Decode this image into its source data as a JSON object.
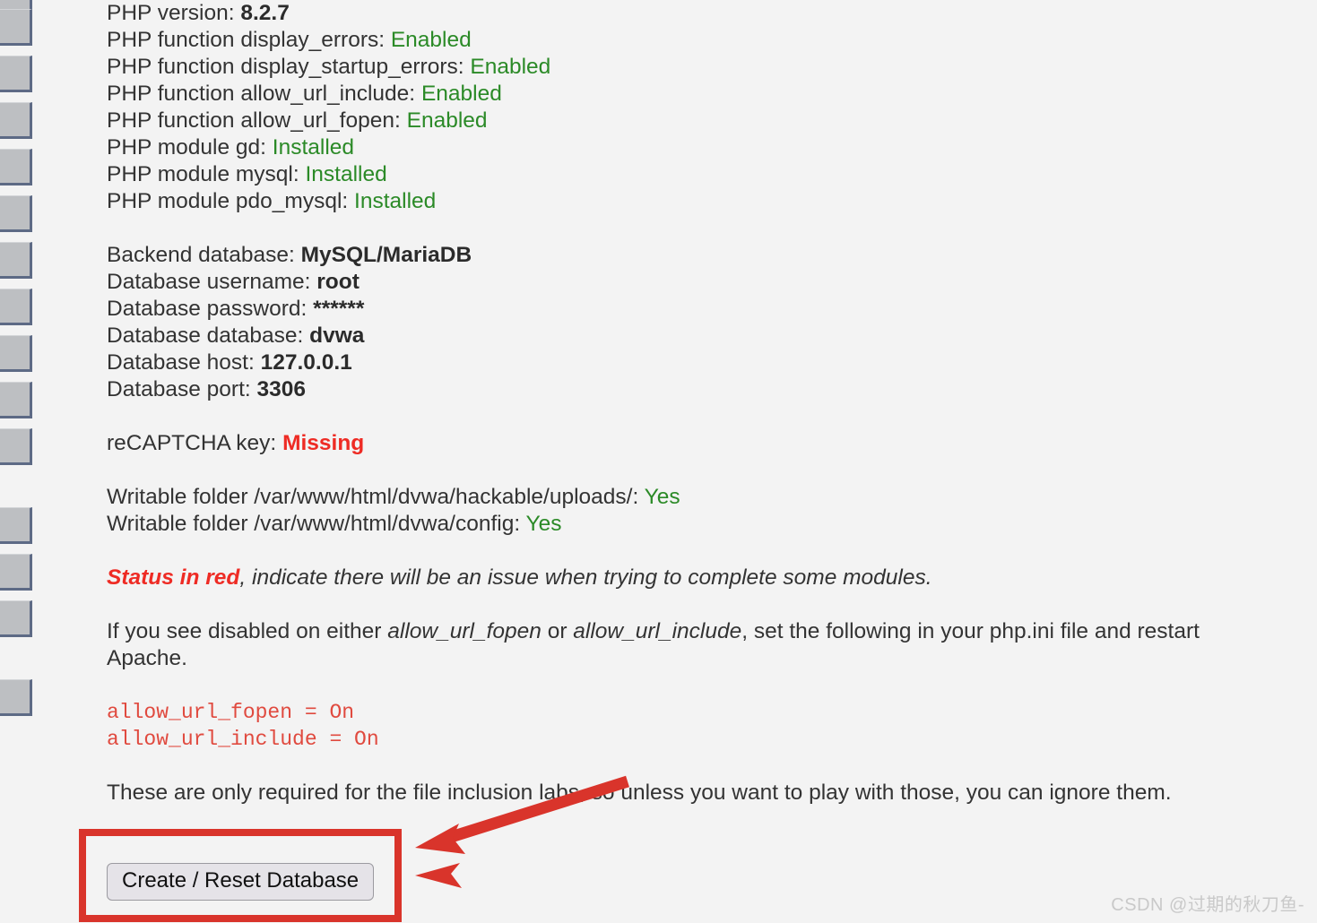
{
  "page": {
    "background_color": "#f3f3f3",
    "text_color": "#333333"
  },
  "sidebar": {
    "item_count": 14,
    "items": [
      {
        "name": "menu-item-1"
      },
      {
        "name": "menu-item-2"
      },
      {
        "name": "menu-item-3"
      },
      {
        "name": "menu-item-4"
      },
      {
        "name": "menu-item-5"
      },
      {
        "name": "menu-item-6"
      },
      {
        "name": "menu-item-7"
      },
      {
        "name": "menu-item-8"
      },
      {
        "name": "menu-item-9"
      },
      {
        "name": "menu-item-10"
      },
      {
        "name": "menu-item-11"
      },
      {
        "name": "menu-item-12"
      },
      {
        "name": "menu-item-13"
      },
      {
        "name": "menu-item-14"
      }
    ]
  },
  "setup_info": {
    "php": [
      {
        "label": "PHP version:",
        "value": "8.2.7",
        "style": "bold"
      },
      {
        "label": "PHP function display_errors:",
        "value": "Enabled",
        "style": "ok"
      },
      {
        "label": "PHP function display_startup_errors:",
        "value": "Enabled",
        "style": "ok"
      },
      {
        "label": "PHP function allow_url_include:",
        "value": "Enabled",
        "style": "ok"
      },
      {
        "label": "PHP function allow_url_fopen:",
        "value": "Enabled",
        "style": "ok"
      },
      {
        "label": "PHP module gd:",
        "value": "Installed",
        "style": "ok"
      },
      {
        "label": "PHP module mysql:",
        "value": "Installed",
        "style": "ok"
      },
      {
        "label": "PHP module pdo_mysql:",
        "value": "Installed",
        "style": "ok"
      }
    ],
    "database": [
      {
        "label": "Backend database:",
        "value": "MySQL/MariaDB",
        "style": "bold"
      },
      {
        "label": "Database username:",
        "value": "root",
        "style": "bold"
      },
      {
        "label": "Database password:",
        "value": "******",
        "style": "bold"
      },
      {
        "label": "Database database:",
        "value": "dvwa",
        "style": "bold"
      },
      {
        "label": "Database host:",
        "value": "127.0.0.1",
        "style": "bold"
      },
      {
        "label": "Database port:",
        "value": "3306",
        "style": "bold"
      }
    ],
    "recaptcha": [
      {
        "label": "reCAPTCHA key:",
        "value": "Missing",
        "style": "bad"
      }
    ],
    "folders": [
      {
        "label": "Writable folder /var/www/html/dvwa/hackable/uploads/:",
        "value": "Yes",
        "style": "ok"
      },
      {
        "label": "Writable folder /var/www/html/dvwa/config:",
        "value": "Yes",
        "style": "ok"
      }
    ]
  },
  "notices": {
    "status_red_lead": "Status in red",
    "status_red_rest": ", indicate there will be an issue when trying to complete some modules.",
    "ini_paragraph_pre": "If you see disabled on either ",
    "ini_paragraph_em1": "allow_url_fopen",
    "ini_paragraph_mid": " or ",
    "ini_paragraph_em2": "allow_url_include",
    "ini_paragraph_post": ", set the following in your php.ini file and restart Apache.",
    "code_line_1": "allow_url_fopen = On",
    "code_line_2": "allow_url_include = On",
    "closing_paragraph": "These are only required for the file inclusion labs, so unless you want to play with those, you can ignore them."
  },
  "actions": {
    "create_reset_db_label": "Create / Reset Database"
  },
  "annotation": {
    "color": "#d9342b",
    "box_present": true,
    "arrow_count": 2
  },
  "watermark": {
    "text": "CSDN @过期的秋刀鱼-"
  },
  "colors": {
    "ok_green": "#2b8a27",
    "error_red": "#ee2b24",
    "code_red": "#e04a3f",
    "annotation_red": "#d9342b",
    "background": "#f3f3f3"
  }
}
